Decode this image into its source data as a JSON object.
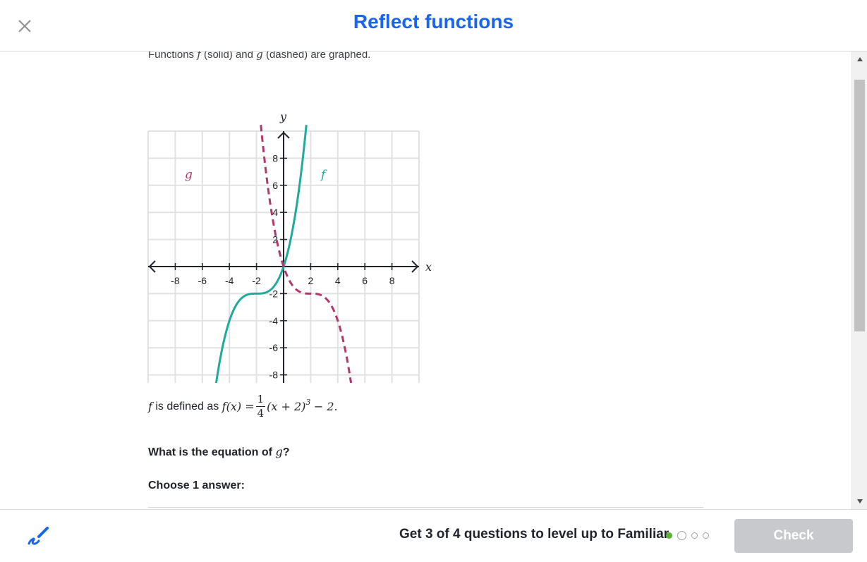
{
  "header": {
    "title": "Reflect functions"
  },
  "intro": {
    "prefix": "Functions",
    "f": "f",
    "solid": "(solid) and",
    "g": "g",
    "dashed": "(dashed) are graphed."
  },
  "graph": {
    "x_axis_label": "x",
    "y_axis_label": "y",
    "f_label": "f",
    "g_label": "g",
    "x_ticks": [
      "-8",
      "-6",
      "-4",
      "-2",
      "2",
      "4",
      "6",
      "8"
    ],
    "y_ticks_pos": [
      "8",
      "6",
      "4",
      "2"
    ],
    "y_ticks_neg": [
      "-2",
      "-4",
      "-6",
      "-8"
    ],
    "colors": {
      "f": "#1fab9a",
      "g": "#b3376b",
      "grid": "#e0e1e3"
    }
  },
  "definition": {
    "f": "f",
    "is_defined_as": "is defined as",
    "lhs": "f(x) =",
    "numerator": "1",
    "denominator": "4",
    "rhs": "(x + 2)",
    "exponent": "3",
    "tail": "− 2."
  },
  "question": {
    "prefix": "What is the equation of",
    "var": "g",
    "suffix": "?"
  },
  "choose": "Choose 1 answer:",
  "footer": {
    "progress_text": "Get 3 of 4 questions to level up to Familiar",
    "check_label": "Check",
    "colors": {
      "dot_done": "#5fb13b",
      "check_disabled": "#c8c9cc"
    }
  }
}
